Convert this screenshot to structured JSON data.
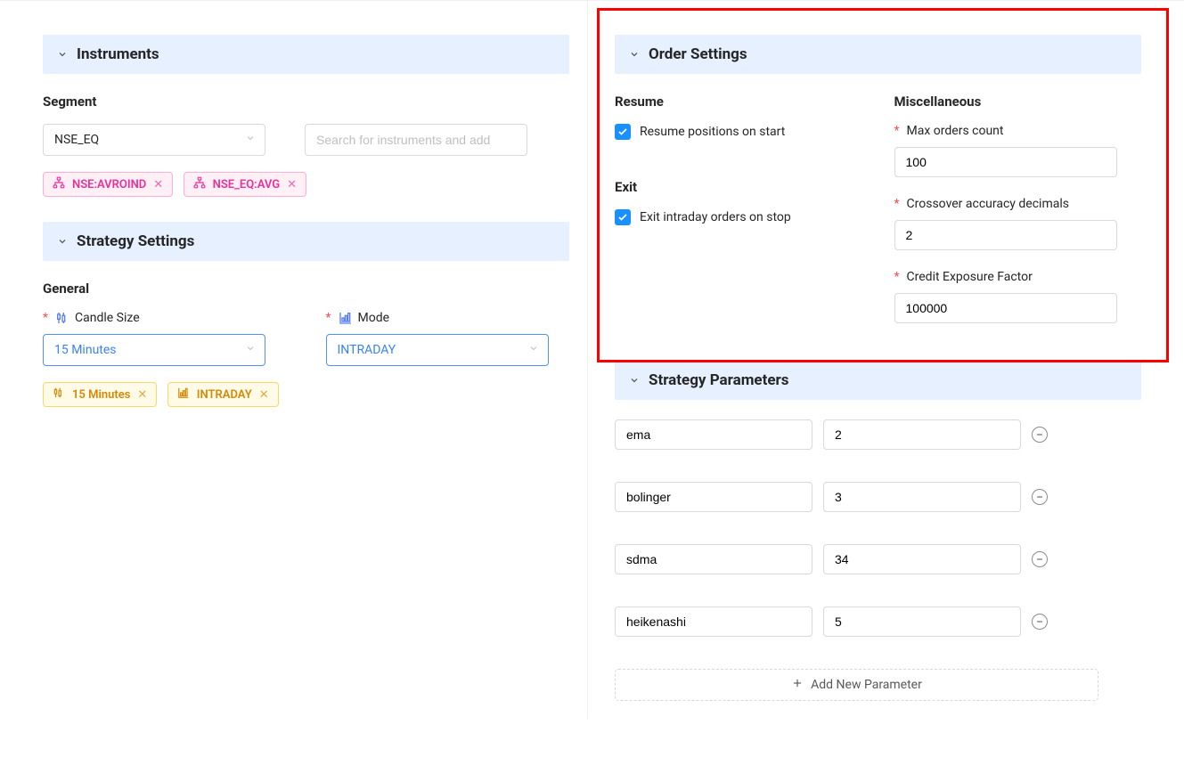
{
  "left": {
    "instruments": {
      "header": "Instruments",
      "segment_label": "Segment",
      "segment_value": "NSE_EQ",
      "search_placeholder": "Search for instruments and add",
      "tags": [
        "NSE:AVROIND",
        "NSE_EQ:AVG"
      ]
    },
    "strategy": {
      "header": "Strategy Settings",
      "general_label": "General",
      "candle_label": "Candle Size",
      "candle_value": "15 Minutes",
      "mode_label": "Mode",
      "mode_value": "INTRADAY",
      "tags": [
        "15 Minutes",
        "INTRADAY"
      ]
    }
  },
  "right": {
    "order": {
      "header": "Order Settings",
      "resume_label": "Resume",
      "resume_checkbox_label": "Resume positions on start",
      "exit_label": "Exit",
      "exit_checkbox_label": "Exit intraday orders on stop",
      "misc_label": "Miscellaneous",
      "max_orders_label": "Max orders count",
      "max_orders_value": "100",
      "crossover_label": "Crossover accuracy decimals",
      "crossover_value": "2",
      "credit_label": "Credit Exposure Factor",
      "credit_value": "100000"
    },
    "params": {
      "header": "Strategy Parameters",
      "rows": [
        {
          "name": "ema",
          "value": "2"
        },
        {
          "name": "bolinger",
          "value": "3"
        },
        {
          "name": "sdma",
          "value": "34"
        },
        {
          "name": "heikenashi",
          "value": "5"
        }
      ],
      "add_label": "Add New Parameter"
    }
  }
}
